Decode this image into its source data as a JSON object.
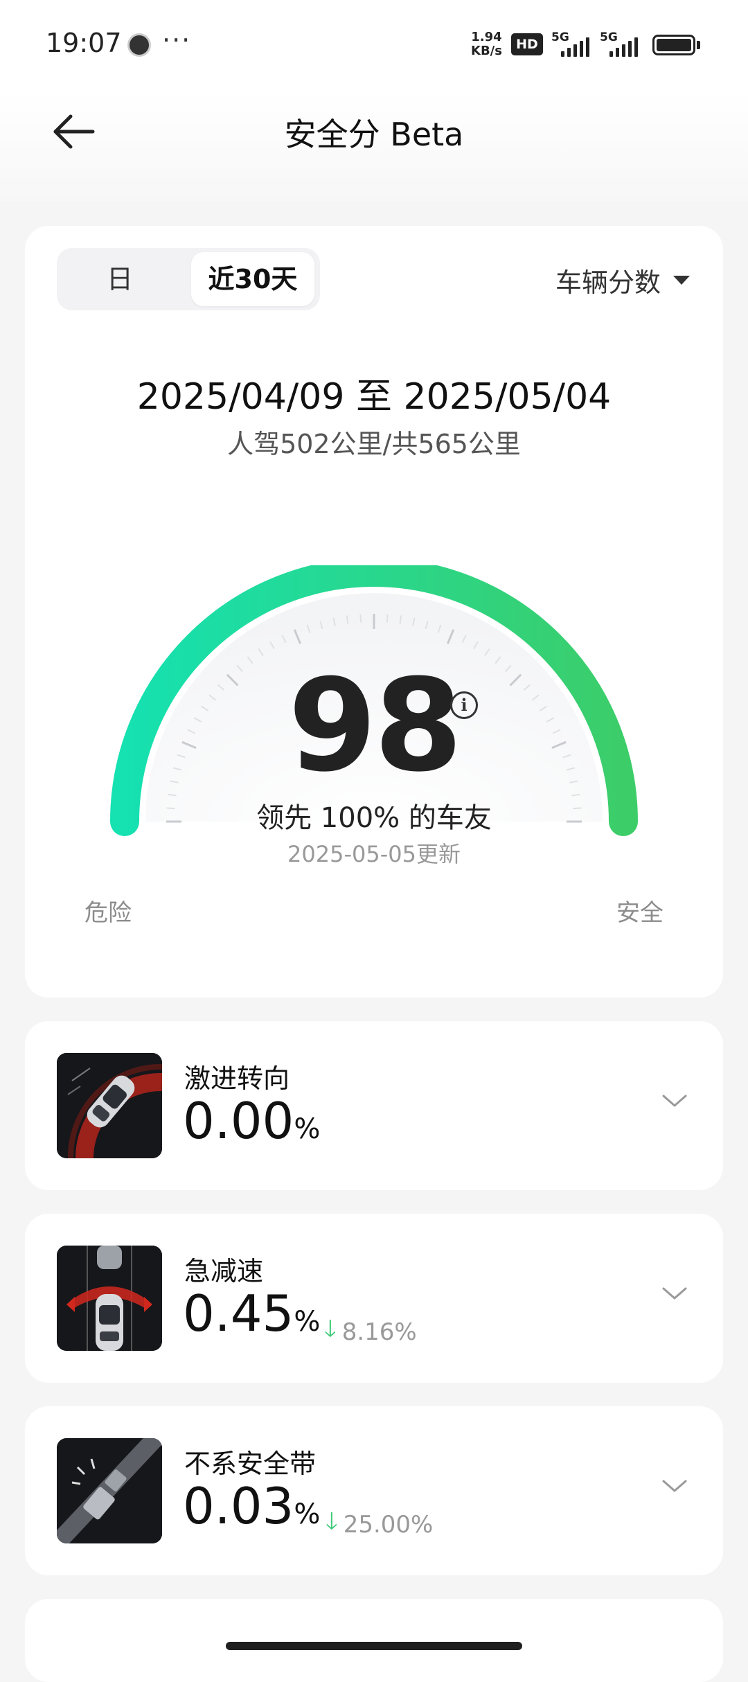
{
  "status_bar": {
    "time": "19:07",
    "more": "···",
    "net_speed_value": "1.94",
    "net_speed_unit": "KB/s",
    "hd_badge": "HD",
    "sim1_label": "5G",
    "sim2_label": "5G",
    "battery_level": 1.0
  },
  "header": {
    "title": "安全分 Beta"
  },
  "summary": {
    "tabs": [
      {
        "label": "日",
        "selected": false
      },
      {
        "label": "近30天",
        "selected": true
      }
    ],
    "dropdown_label": "车辆分数",
    "date_range": "2025/04/09 至 2025/05/04",
    "distance": "人驾502公里/共565公里",
    "score": "98",
    "info_glyph": "i",
    "rank_text": "领先 100% 的车友",
    "updated_text": "2025-05-05更新",
    "gauge_min_label": "危险",
    "gauge_max_label": "安全",
    "gauge_colors": [
      "#15e1b1",
      "#3ccd69"
    ]
  },
  "metrics": [
    {
      "title": "激进转向",
      "value": "0.00",
      "unit": "%",
      "change": "",
      "icon": "aggressive-steering-icon"
    },
    {
      "title": "急减速",
      "value": "0.45",
      "unit": "%",
      "change": "8.16%",
      "change_dir": "down",
      "icon": "hard-braking-icon"
    },
    {
      "title": "不系安全带",
      "value": "0.03",
      "unit": "%",
      "change": "25.00%",
      "change_dir": "down",
      "icon": "seatbelt-unbuckled-icon"
    }
  ],
  "accent_colors": {
    "down_arrow": "#3fc977",
    "brake_red": "#e03a2f"
  }
}
